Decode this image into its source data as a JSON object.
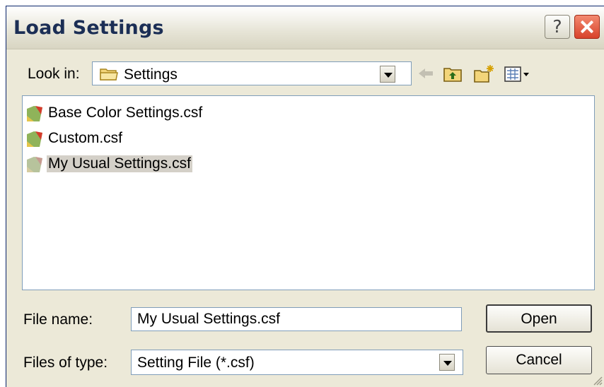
{
  "dialog": {
    "title": "Load Settings",
    "help_glyph": "?",
    "close_icon": "close-icon"
  },
  "lookin": {
    "label": "Look in:",
    "value": "Settings",
    "icon": "folder-icon"
  },
  "toolbar": {
    "icons": [
      "back-arrow-icon",
      "up-folder-icon",
      "new-folder-icon",
      "view-menu-icon"
    ]
  },
  "files": [
    {
      "name": "Base Color Settings.csf",
      "icon": "csf-file-icon",
      "selected": false
    },
    {
      "name": "Custom.csf",
      "icon": "csf-file-icon",
      "selected": false
    },
    {
      "name": "My Usual Settings.csf",
      "icon": "csf-file-icon",
      "selected": true
    }
  ],
  "filename": {
    "label": "File name:",
    "value": "My Usual Settings.csf"
  },
  "filetype": {
    "label": "Files of type:",
    "value": "Setting File (*.csf)"
  },
  "buttons": {
    "open": "Open",
    "cancel": "Cancel"
  },
  "colors": {
    "dialog_bg": "#ece9d8",
    "close_button": "#d8422a",
    "selection": "#d4d0c8",
    "field_border": "#7f9db9"
  }
}
